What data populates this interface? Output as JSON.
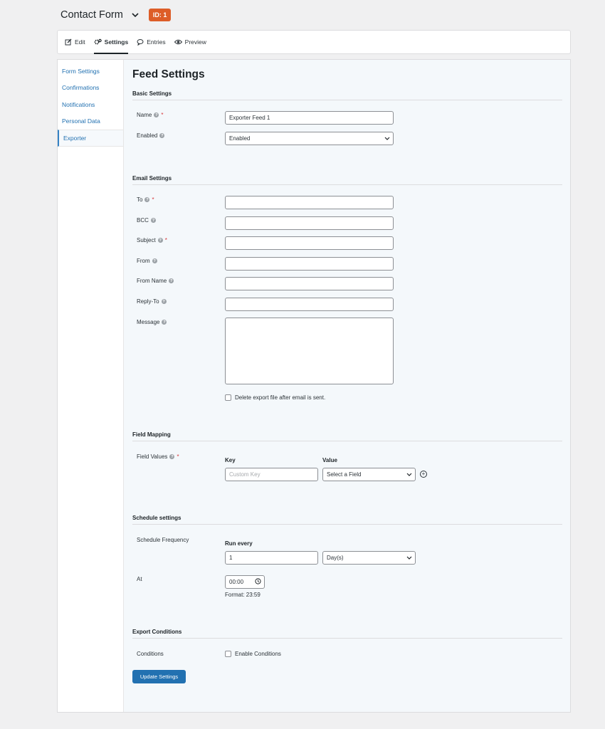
{
  "header": {
    "title": "Contact Form",
    "id_badge": "ID: 1"
  },
  "tabs": [
    {
      "label": "Edit",
      "icon": "edit-icon"
    },
    {
      "label": "Settings",
      "icon": "gear-icon",
      "active": true
    },
    {
      "label": "Entries",
      "icon": "chat-bubble-icon"
    },
    {
      "label": "Preview",
      "icon": "eye-icon"
    }
  ],
  "sidebar": {
    "items": [
      {
        "label": "Form Settings"
      },
      {
        "label": "Confirmations"
      },
      {
        "label": "Notifications"
      },
      {
        "label": "Personal Data"
      },
      {
        "label": "Exporter",
        "active": true
      }
    ]
  },
  "page": {
    "title": "Feed Settings"
  },
  "basic": {
    "heading": "Basic Settings",
    "name_label": "Name",
    "name_value": "Exporter Feed 1",
    "enabled_label": "Enabled",
    "enabled_value": "Enabled"
  },
  "email": {
    "heading": "Email Settings",
    "to_label": "To",
    "bcc_label": "BCC",
    "subject_label": "Subject",
    "from_label": "From",
    "from_name_label": "From Name",
    "reply_to_label": "Reply-To",
    "message_label": "Message",
    "delete_checkbox_label": "Delete export file after email is sent."
  },
  "mapping": {
    "heading": "Field Mapping",
    "field_values_label": "Field Values",
    "key_header": "Key",
    "value_header": "Value",
    "key_placeholder": "Custom Key",
    "value_select": "Select a Field"
  },
  "schedule": {
    "heading": "Schedule settings",
    "frequency_label": "Schedule Frequency",
    "run_every_label": "Run every",
    "run_every_value": "1",
    "unit_value": "Day(s)",
    "at_label": "At",
    "time_value": "00:00",
    "format_hint": "Format: 23:59"
  },
  "conditions": {
    "heading": "Export Conditions",
    "label": "Conditions",
    "checkbox_label": "Enable Conditions"
  },
  "actions": {
    "update_label": "Update Settings"
  },
  "colors": {
    "accent": "#2271b1",
    "badge": "#dd5d28",
    "required": "#d63638"
  }
}
